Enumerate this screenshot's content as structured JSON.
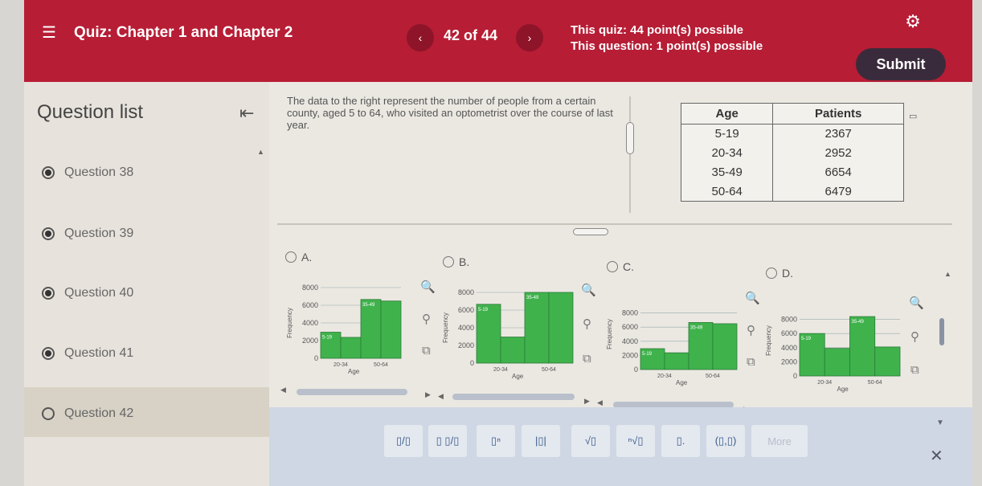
{
  "header": {
    "menu_icon": "hamburger-icon",
    "title": "Quiz: Chapter 1 and Chapter 2",
    "prev_label": "‹",
    "next_label": "›",
    "pager": "42 of 44",
    "quiz_points": "This quiz: 44 point(s) possible",
    "question_points": "This question: 1 point(s) possible",
    "settings_icon": "gear-icon",
    "submit_label": "Submit",
    "colors": {
      "bar": "#b71d35",
      "submit": "#3a2b3c"
    }
  },
  "sidebar": {
    "title": "Question list",
    "collapse_icon": "collapse-left-icon",
    "items": [
      {
        "label": "Question 38",
        "answered": true
      },
      {
        "label": "Question 39",
        "answered": true
      },
      {
        "label": "Question 40",
        "answered": true
      },
      {
        "label": "Question 41",
        "answered": true
      },
      {
        "label": "Question 42",
        "answered": false
      }
    ]
  },
  "question": {
    "text": "The data to the right represent the number of people from a certain county, aged 5 to 64, who visited an optometrist over the course of last year.",
    "table": {
      "headers": [
        "Age",
        "Patients"
      ],
      "rows": [
        [
          "5-19",
          "2367"
        ],
        [
          "20-34",
          "2952"
        ],
        [
          "35-49",
          "6654"
        ],
        [
          "50-64",
          "6479"
        ]
      ]
    }
  },
  "options": [
    {
      "label": "A.",
      "chart_data": {
        "type": "bar",
        "categories": [
          "5-19",
          "20-34",
          "35-49",
          "50-64"
        ],
        "values": [
          2952,
          2367,
          6654,
          6479
        ],
        "y_ticks": [
          "8000",
          "6000",
          "4000",
          "2000",
          "0"
        ],
        "x_ticks": [
          "20-34",
          "50-64"
        ],
        "bar_labels": [
          "5-19",
          "35-49"
        ],
        "ylim": [
          0,
          8000
        ],
        "xlabel": "Age",
        "ylabel": "Frequency",
        "color": "#3fb24c"
      }
    },
    {
      "label": "B.",
      "chart_data": {
        "type": "bar",
        "categories": [
          "5-19",
          "20-34",
          "35-49",
          "50-64"
        ],
        "values": [
          6654,
          2952,
          8000,
          8000
        ],
        "y_ticks": [
          "8000",
          "6000",
          "4000",
          "2000",
          "0"
        ],
        "x_ticks": [
          "20-34",
          "50-64"
        ],
        "bar_labels": [
          "5-19",
          "35-49"
        ],
        "ylim": [
          0,
          8000
        ],
        "xlabel": "Age",
        "ylabel": "Frequency",
        "color": "#3fb24c"
      }
    },
    {
      "label": "C.",
      "chart_data": {
        "type": "bar",
        "categories": [
          "5-19",
          "20-34",
          "35-49",
          "50-64"
        ],
        "values": [
          2952,
          2367,
          6654,
          6479
        ],
        "y_ticks": [
          "8000",
          "6000",
          "4000",
          "2000",
          "0"
        ],
        "x_ticks": [
          "20-34",
          "50-64"
        ],
        "bar_labels": [
          "5-19",
          "35-49"
        ],
        "ylim": [
          0,
          10000
        ],
        "xlabel": "Age",
        "ylabel": "Frequency",
        "color": "#3fb24c"
      }
    },
    {
      "label": "D.",
      "chart_data": {
        "type": "bar",
        "categories": [
          "5-19",
          "20-34",
          "35-49",
          "50-64"
        ],
        "values": [
          6000,
          3900,
          8400,
          4100
        ],
        "y_ticks": [
          "8000",
          "6000",
          "4000",
          "2000",
          "0"
        ],
        "x_ticks": [
          "20-34",
          "50-64"
        ],
        "bar_labels": [
          "5-19",
          "35-49"
        ],
        "ylim": [
          0,
          10000
        ],
        "xlabel": "Age",
        "ylabel": "Frequency",
        "color": "#3fb24c"
      }
    }
  ],
  "chart_tools": {
    "zoom_in": "zoom-in-icon",
    "zoom_out": "zoom-out-icon",
    "popout": "popout-icon"
  },
  "math_toolbar": {
    "buttons": [
      {
        "label": "▯/▯",
        "icon": "fraction-icon"
      },
      {
        "label": "▯ ▯/▯",
        "icon": "mixed-number-icon"
      },
      {
        "label": "▯ⁿ",
        "icon": "exponent-icon"
      },
      {
        "label": "|▯|",
        "icon": "absolute-value-icon"
      },
      {
        "label": "√▯",
        "icon": "square-root-icon"
      },
      {
        "label": "ⁿ√▯",
        "icon": "nth-root-icon"
      },
      {
        "label": "▯.",
        "icon": "decimal-icon"
      },
      {
        "label": "(▯,▯)",
        "icon": "ordered-pair-icon"
      },
      {
        "label": "More",
        "icon": "more-icon"
      }
    ],
    "close_icon": "close-icon"
  }
}
